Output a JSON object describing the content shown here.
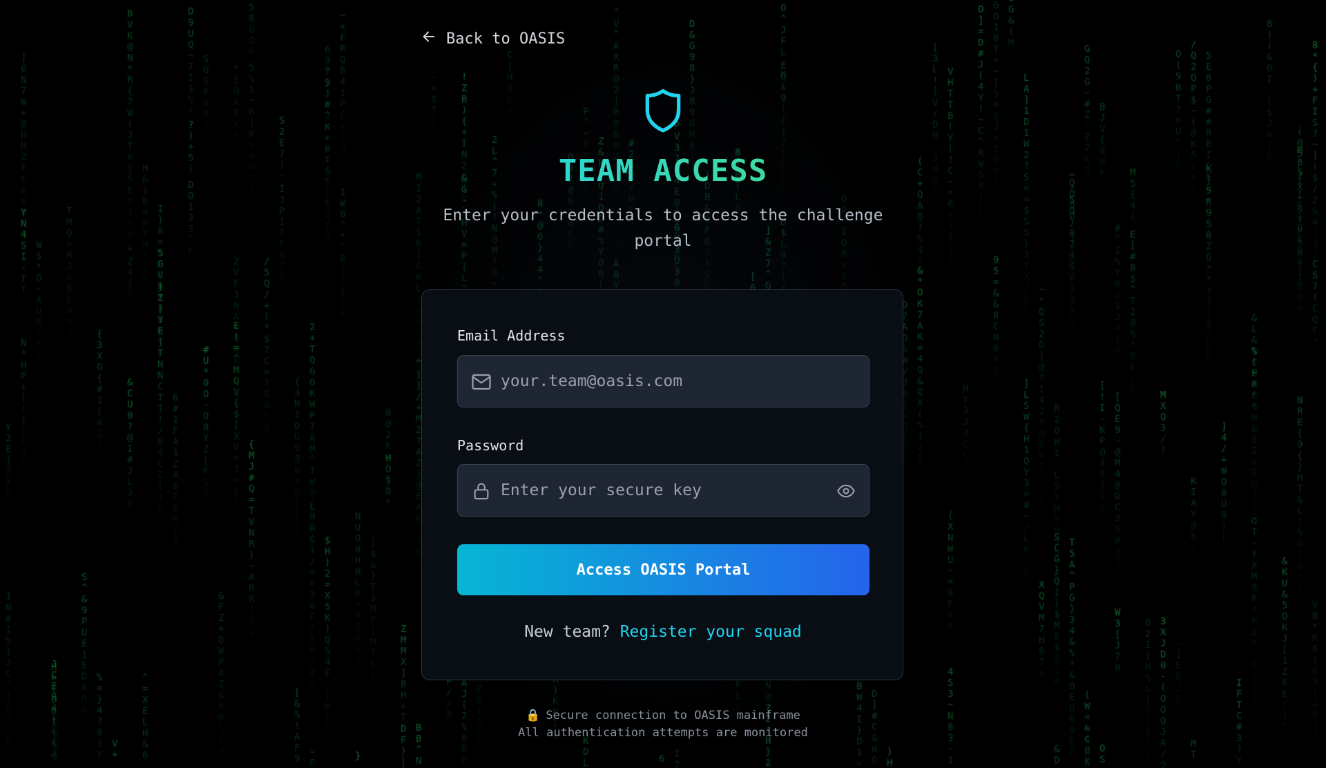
{
  "nav": {
    "back_label": "Back to OASIS"
  },
  "header": {
    "title": "TEAM ACCESS",
    "subtitle": "Enter your credentials to access the challenge portal"
  },
  "form": {
    "email_label": "Email Address",
    "email_placeholder": "your.team@oasis.com",
    "email_value": "",
    "password_label": "Password",
    "password_placeholder": "Enter your secure key",
    "password_value": "",
    "submit_label": "Access OASIS Portal",
    "signup_prompt": "New team?",
    "signup_link": "Register your squad"
  },
  "footer": {
    "lock_icon": "🔒",
    "line1": "Secure connection to OASIS mainframe",
    "line2": "All authentication attempts are monitored"
  },
  "icons": {
    "back": "arrow-left-icon",
    "shield": "shield-icon",
    "email": "mail-icon",
    "password": "lock-icon",
    "toggle": "eye-icon"
  },
  "colors": {
    "background": "#000000",
    "card": "#090d14",
    "input": "#1e2533",
    "accent_cyan": "#22d3ee",
    "accent_green": "#4ade80",
    "button_start": "#06b6d4",
    "button_end": "#2563eb",
    "matrix_green": "#16a34a"
  }
}
